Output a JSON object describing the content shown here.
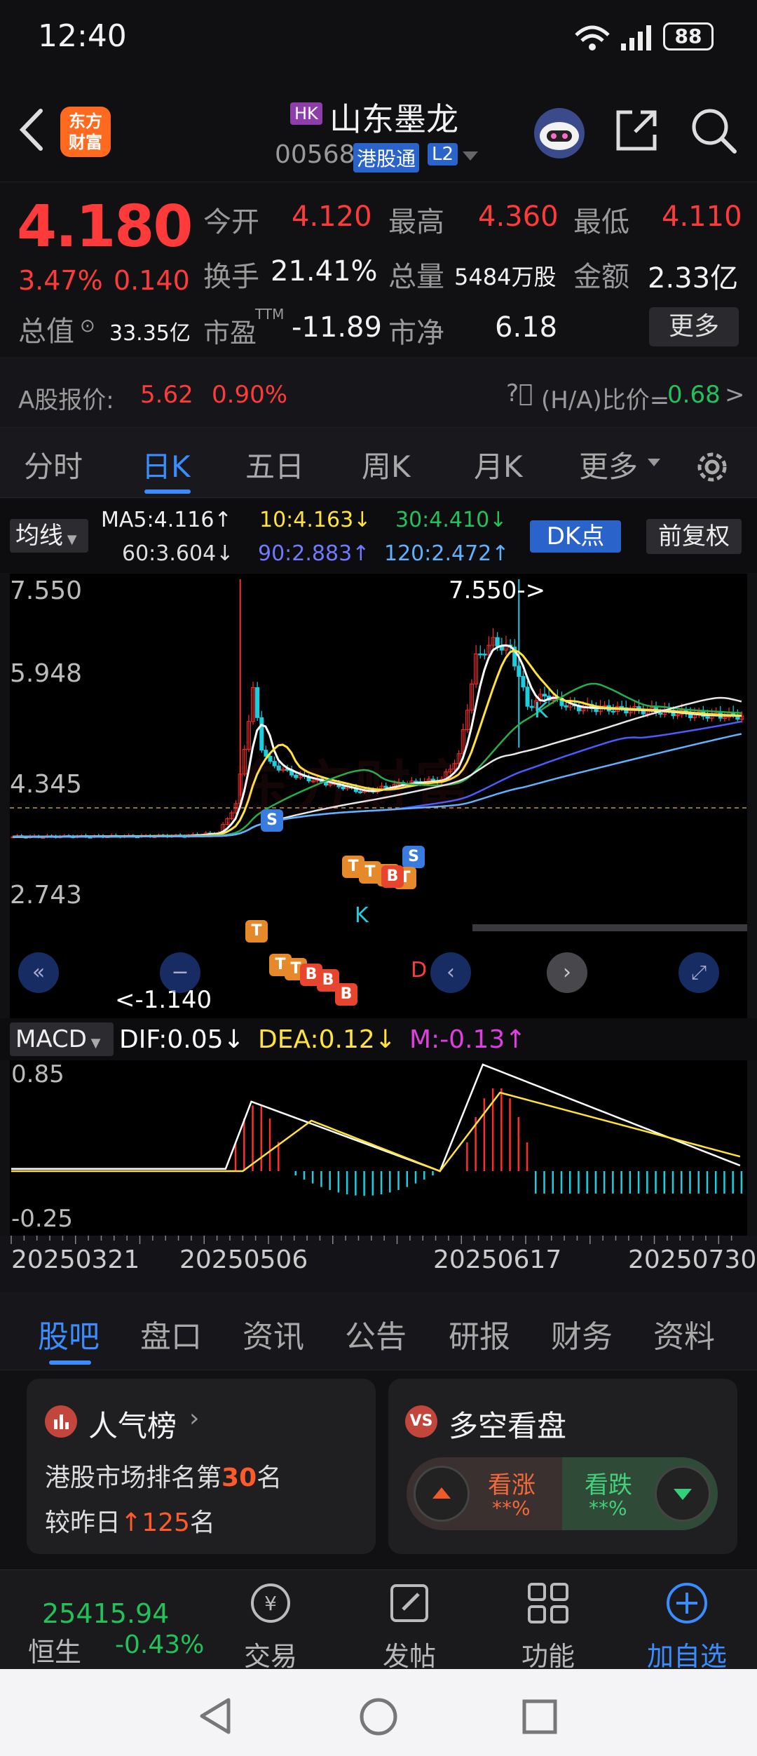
{
  "status": {
    "time": "12:40",
    "battery": "88"
  },
  "header": {
    "logo_line1": "东方",
    "logo_line2": "财富",
    "market_badge": "HK",
    "stock_name": "山东墨龙",
    "stock_code": "00568",
    "connect_badge": "港股通",
    "level_badge": "L2"
  },
  "quote": {
    "price": "4.180",
    "change_pct": "3.47%",
    "change_amt": "0.140",
    "open_label": "今开",
    "open": "4.120",
    "high_label": "最高",
    "high": "4.360",
    "low_label": "最低",
    "low": "4.110",
    "turnover_label": "换手",
    "turnover": "21.41%",
    "volume_label": "总量",
    "volume": "5484万股",
    "amount_label": "金额",
    "amount": "2.33亿",
    "mktcap_label": "总值",
    "mktcap": "33.35亿",
    "pe_label": "市盈",
    "pe_sup": "TTM",
    "pe": "-11.89",
    "pb_label": "市净",
    "pb": "6.18",
    "more_button": "更多"
  },
  "ashare": {
    "label": "A股报价:",
    "price": "5.62",
    "pct": "0.90%",
    "ha_label": "(H/A)比价=",
    "ha_value": "0.68",
    "arrow": ">"
  },
  "ktabs": {
    "items": [
      "分时",
      "日K",
      "五日",
      "周K",
      "月K",
      "更多"
    ],
    "active": "日K"
  },
  "ma_legend": {
    "selector": "均线",
    "ma5": "MA5:4.116↑",
    "ma10": "10:4.163↓",
    "ma30": "30:4.410↓",
    "ma60": "60:3.604↓",
    "ma90": "90:2.883↑",
    "ma120": "120:2.472↑",
    "dk_button": "DK点",
    "fq_button": "前复权"
  },
  "kchart": {
    "y_labels": [
      "7.550",
      "5.948",
      "4.345",
      "2.743"
    ],
    "max_annotation": "7.550->",
    "min_annotation": "<-1.140",
    "watermark": "东方财富",
    "colors": {
      "up": "#ff2d2d",
      "down": "#19d0e0",
      "ma5": "#ffffff",
      "ma10": "#ffe23a",
      "ma30": "#22b04a",
      "ma60": "#e8e8e8",
      "ma90": "#4a5cff",
      "ma120": "#5fb2ff"
    }
  },
  "macd": {
    "selector": "MACD",
    "dif": "DIF:0.05↓",
    "dea": "DEA:0.12↓",
    "m": "M:-0.13↑",
    "top_label": "0.85",
    "bottom_label": "-0.25"
  },
  "dates": [
    "20250321",
    "20250506",
    "20250617",
    "20250730"
  ],
  "bottom_tabs": {
    "items": [
      "股吧",
      "盘口",
      "资讯",
      "公告",
      "研报",
      "财务",
      "资料"
    ],
    "active": "股吧"
  },
  "popularity": {
    "title": "人气榜",
    "line1_prefix": "港股市场排名第",
    "rank": "30",
    "line1_suffix": "名",
    "line2_prefix": "较昨日",
    "change": "125",
    "line2_suffix": "名"
  },
  "sentiment": {
    "title": "多空看盘",
    "bull_label": "看涨",
    "bull_value": "**%",
    "bear_label": "看跌",
    "bear_value": "**%"
  },
  "toolbar": {
    "index_value": "25415.94",
    "index_name": "恒生",
    "index_change": "-0.43%",
    "trade": "交易",
    "post": "发帖",
    "function": "功能",
    "add_watch": "加自选"
  }
}
